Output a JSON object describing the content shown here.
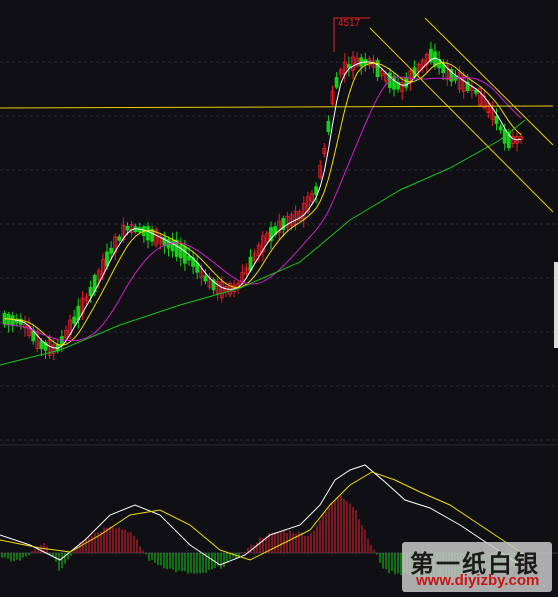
{
  "annotations": {
    "peak_label": "4517"
  },
  "watermark": {
    "title": "第一纸白银",
    "url": "www.diyizby.com"
  },
  "colors": {
    "background": "#0f0f14",
    "up_candle": "#e8202a",
    "down_candle": "#16d216",
    "ma_short": "#ffffff",
    "ma_mid": "#f0e000",
    "ma_long": "#d020c8",
    "ma_slow": "#18c418",
    "resistance_line": "#e8d000",
    "channel_line": "#e8d000",
    "macd_dif": "#ffffff",
    "macd_dea": "#f0e000",
    "macd_hist_up": "#e8202a",
    "macd_hist_down": "#16d216"
  },
  "chart_data": [
    {
      "type": "candlestick",
      "panel": "price",
      "title": "",
      "peak_value": 4517,
      "resistance_level_label": "",
      "overlays": [
        "MA short (white)",
        "MA mid (yellow)",
        "MA long (magenta)",
        "MA slow (green)",
        "descending channel (yellow)",
        "horizontal resistance (yellow)"
      ],
      "trend_summary": [
        "rise",
        "consolidation",
        "dip",
        "sharp rally to 4517 peak",
        "pullback in descending channel"
      ]
    },
    {
      "type": "bar",
      "panel": "MACD",
      "title": "",
      "series": [
        {
          "kind": "histogram"
        },
        {
          "kind": "DIF line"
        },
        {
          "kind": "DEA line"
        }
      ],
      "zero_line": true
    }
  ]
}
